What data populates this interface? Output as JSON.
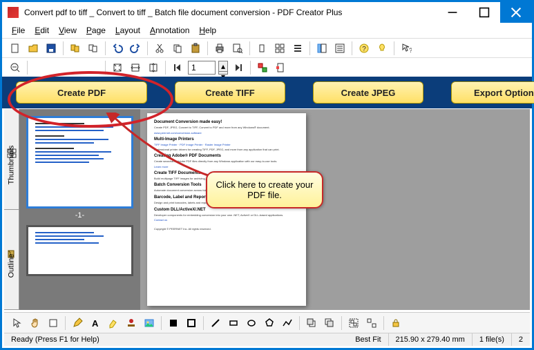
{
  "window": {
    "title": "Convert pdf to tiff _ Convert to tiff _ Batch file document conversion - PDF Creator Plus"
  },
  "menu": {
    "items": [
      "File",
      "Edit",
      "View",
      "Page",
      "Layout",
      "Annotation",
      "Help"
    ]
  },
  "toolbar2": {
    "page_value": "1"
  },
  "bigButtons": {
    "createPDF": "Create PDF",
    "createTIFF": "Create TIFF",
    "createJPEG": "Create JPEG",
    "exportOptions": "Export Options"
  },
  "sideTabs": {
    "thumbnails": "Thumbnails",
    "outline": "Outline"
  },
  "thumbs": {
    "page1Label": "-1-"
  },
  "preview": {
    "h1": "Document Conversion made easy!",
    "p1": "Create PDF, JPEG, Convert to TIFF, Convert to PDF and more from any Windows® document.",
    "h2": "Multi-Image Printers",
    "h3": "Creating Adobe® PDF Documents",
    "h4": "Create TIFF Documents",
    "h5": "Batch Conversion Tools",
    "h6": "Barcode, Label and Reporting Software",
    "h7": "Custom DLL/ActiveX/.NET"
  },
  "callout": {
    "text": "Click here to create your PDF file."
  },
  "status": {
    "ready": "Ready (Press F1 for Help)",
    "fit": "Best Fit",
    "dims": "215.90 x 279.40 mm",
    "files": "1 file(s)",
    "pages": "2"
  }
}
